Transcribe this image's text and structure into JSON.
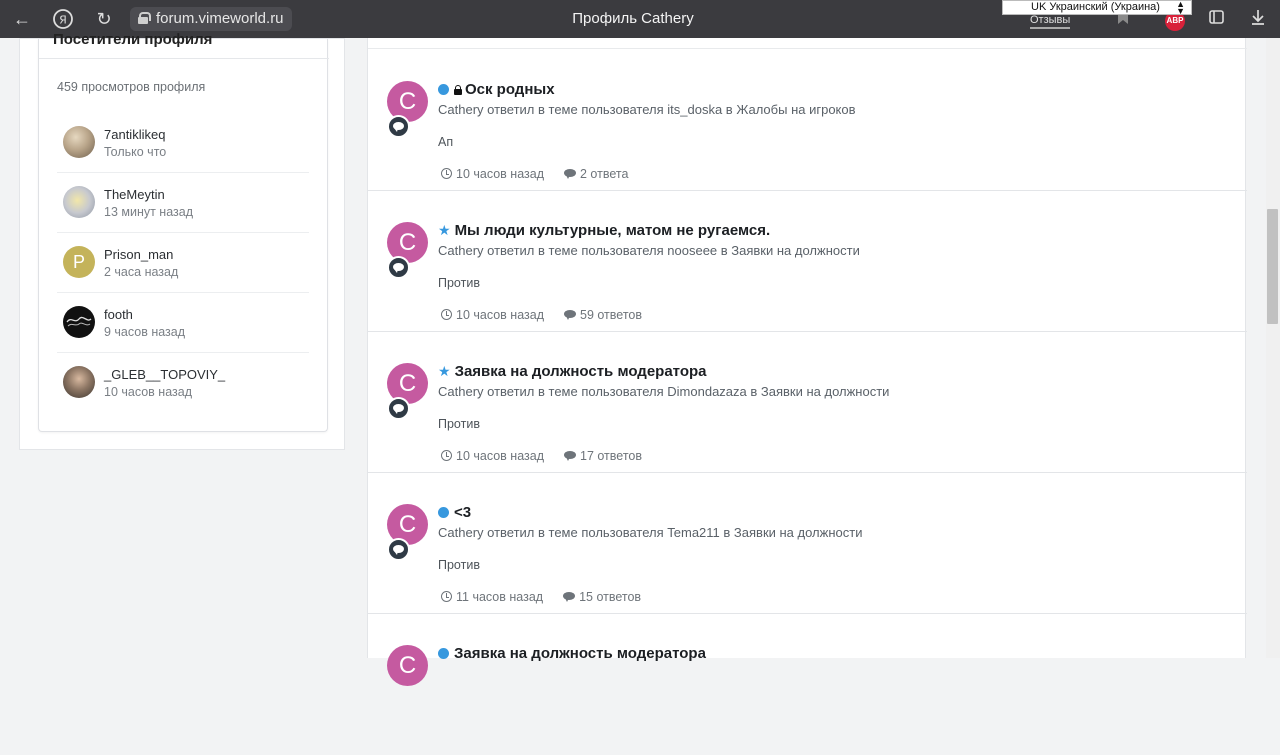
{
  "browser": {
    "url": "forum.vimeworld.ru",
    "title": "Профиль Cathery",
    "lang_select": "UK Украинский (Украина)",
    "feedback": "Отзывы",
    "abp": "ABP",
    "back_icon": "arrow-left-icon",
    "yandex_icon": "yandex-logo-icon",
    "reload_icon": "reload-icon"
  },
  "sidebar": {
    "heading": "Посетители профиля",
    "views": "459 просмотров профиля",
    "visitors": [
      {
        "name": "7antiklikeq",
        "time": "Только что",
        "avatar_color": "#b9a58a"
      },
      {
        "name": "TheMeytin",
        "time": "13 минут назад",
        "avatar_color": "#c7c9cf"
      },
      {
        "name": "Prison_man",
        "time": "2 часа назад",
        "avatar_color": "#c4b35a",
        "avatar_letter": "P"
      },
      {
        "name": "footh",
        "time": "9 часов назад",
        "avatar_color": "#111111"
      },
      {
        "name": "_GLEB__TOPOVIY_",
        "time": "10 часов назад",
        "avatar_color": "#5c5248"
      }
    ]
  },
  "posts": [
    {
      "title": "Оск родных",
      "marker": "dot-locked",
      "meta": "Cathery ответил в теме пользователя its_doska в Жалобы на игроков",
      "snippet": "Ап",
      "time": "10 часов назад",
      "replies": "2 ответа",
      "avatar_letter": "C"
    },
    {
      "title": "Мы люди культурные, матом не ругаемся.",
      "marker": "star",
      "meta": "Cathery ответил в теме пользователя nooseee в Заявки на должности",
      "snippet": "Против",
      "time": "10 часов назад",
      "replies": "59 ответов",
      "avatar_letter": "C"
    },
    {
      "title": "Заявка на должность модератора",
      "marker": "star",
      "meta": "Cathery ответил в теме пользователя Dimondazaza в Заявки на должности",
      "snippet": "Против",
      "time": "10 часов назад",
      "replies": "17 ответов",
      "avatar_letter": "C"
    },
    {
      "title": "<3",
      "marker": "dot",
      "meta": "Cathery ответил в теме пользователя Tema211 в Заявки на должности",
      "snippet": "Против",
      "time": "11 часов назад",
      "replies": "15 ответов",
      "avatar_letter": "C"
    },
    {
      "title": "Заявка на должность модератора",
      "marker": "dot",
      "meta": "",
      "snippet": "",
      "time": "",
      "replies": "",
      "avatar_letter": "C"
    }
  ],
  "colors": {
    "accent": "#3798de",
    "avatar": "#c55aa0",
    "browser_bar": "#3b3b3f"
  }
}
